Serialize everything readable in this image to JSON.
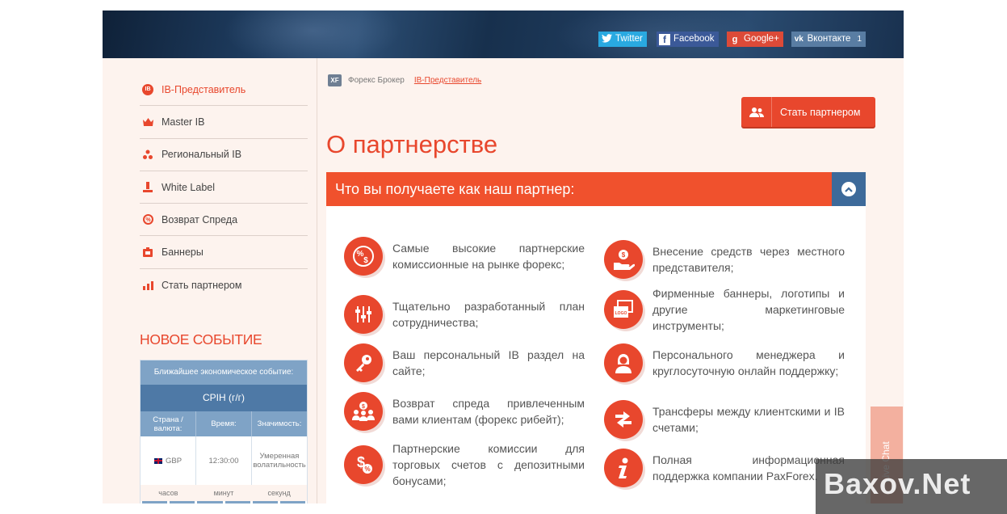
{
  "social": {
    "twitter": "Twitter",
    "facebook": "Facebook",
    "googleplus": "Google+",
    "vk": "Вконтакте",
    "vk_count": "1"
  },
  "sidebar": {
    "items": [
      {
        "label": "IB-Представитель",
        "icon": "ib-icon",
        "active": true
      },
      {
        "label": "Master IB",
        "icon": "crown-icon"
      },
      {
        "label": "Региональный IB",
        "icon": "regional-icon"
      },
      {
        "label": "White Label",
        "icon": "white-label-icon"
      },
      {
        "label": "Возврат Спреда",
        "icon": "spread-return-icon"
      },
      {
        "label": "Баннеры",
        "icon": "banner-icon"
      },
      {
        "label": "Стать партнером",
        "icon": "partner-chart-icon"
      }
    ]
  },
  "event": {
    "title": "НОВОЕ СОБЫТИЕ",
    "header": "Ближайшее экономическое событие:",
    "name": "CPIH (г/г)",
    "col_country": "Страна / валюта:",
    "col_time": "Время:",
    "col_importance": "Значимость:",
    "currency": "GBP",
    "time": "12:30:00",
    "importance": "Умеренная волатильность",
    "timer_hours": "часов",
    "timer_minutes": "минут",
    "timer_seconds": "секунд"
  },
  "breadcrumb": {
    "logo_text": "XF",
    "parent": "Форекс Брокер",
    "current": "IB-Представитель"
  },
  "cta": {
    "label": "Стать партнером"
  },
  "page_title": "О партнерстве",
  "accordion": {
    "title": "Что вы получаете как наш партнер:"
  },
  "features_left": [
    {
      "text": "Самые высокие партнерские комиссионные на рынке форекс;",
      "icon": "percent-dollar-icon"
    },
    {
      "text": "Тщательно разработанный план сотрудничества;",
      "icon": "sliders-icon"
    },
    {
      "text": "Ваш персональный IB раздел на сайте;",
      "icon": "key-icon"
    },
    {
      "text": "Возврат спреда привлеченным вами клиентам (форекс рибейт);",
      "icon": "clients-dollar-icon"
    },
    {
      "text": "Партнерские комиссии для торговых счетов с депозитными бонусами;",
      "icon": "dollar-percent-icon"
    }
  ],
  "features_right": [
    {
      "text": "Внесение средств через местного представителя;",
      "icon": "hand-money-icon"
    },
    {
      "text": "Фирменные баннеры, логотипы и другие маркетинговые инструменты;",
      "icon": "logo-banner-icon"
    },
    {
      "text": "Персонального менеджера и круглосуточную онлайн поддержку;",
      "icon": "manager-icon"
    },
    {
      "text": "Трансферы между клиентскими и IB счетами;",
      "icon": "transfer-arrows-icon"
    },
    {
      "text": "Полная информационная поддержка компании PaxForex.",
      "icon": "info-icon"
    }
  ],
  "live_chat": "Live Chat",
  "watermark": "Baxov.Net",
  "colors": {
    "accent": "#e8472d",
    "header_bar": "#f0512d",
    "toggle": "#3d6a9a",
    "event_blue": "#4e79a6"
  }
}
